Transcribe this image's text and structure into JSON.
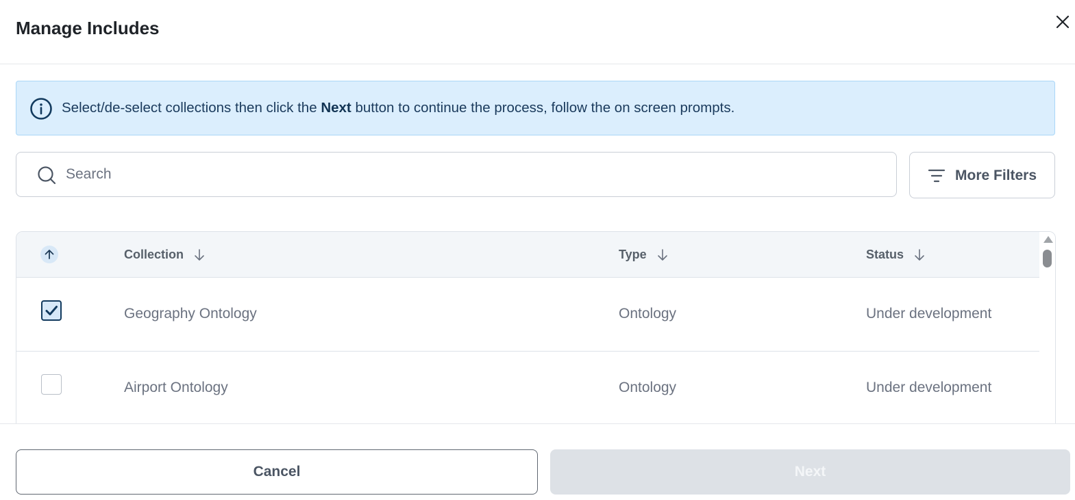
{
  "dialog": {
    "title": "Manage Includes",
    "close_icon": "close-icon"
  },
  "info_banner": {
    "icon": "info-circle-icon",
    "text_before": "Select/de-select collections then click the ",
    "text_bold": "Next",
    "text_after": " button to continue the process, follow the on screen prompts."
  },
  "search": {
    "icon": "search-icon",
    "placeholder": "Search",
    "value": ""
  },
  "filters": {
    "icon": "filter-lines-icon",
    "label": "More Filters"
  },
  "table": {
    "select_column_icon": "arrow-up-icon",
    "columns": [
      {
        "label": "Collection",
        "sort_icon": "arrow-down-icon"
      },
      {
        "label": "Type",
        "sort_icon": "arrow-down-icon"
      },
      {
        "label": "Status",
        "sort_icon": "arrow-down-icon"
      }
    ],
    "rows": [
      {
        "checked": true,
        "collection": "Geography Ontology",
        "type": "Ontology",
        "status": "Under development"
      },
      {
        "checked": false,
        "collection": "Airport Ontology",
        "type": "Ontology",
        "status": "Under development"
      }
    ]
  },
  "footer": {
    "cancel_label": "Cancel",
    "next_label": "Next",
    "next_disabled": true
  },
  "colors": {
    "info_background": "#dbeefd",
    "info_border": "#a9d6f7",
    "checkbox_checked": "#123a5e",
    "disabled_button": "#dde1e6"
  }
}
